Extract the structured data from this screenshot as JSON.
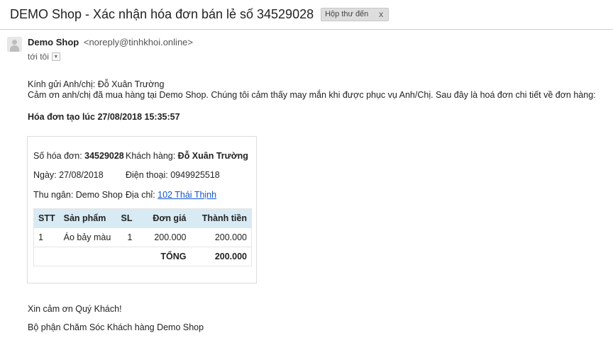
{
  "email": {
    "subject": "DEMO Shop - Xác nhận hóa đơn bán lẻ số 34529028",
    "label": "Hộp thư đến",
    "label_close": "x",
    "sender_name": "Demo Shop",
    "sender_email": "<noreply@tinhkhoi.online>",
    "to_text": "tới tôi",
    "to_toggle_icon": "▼"
  },
  "body": {
    "greeting": "Kính gửi Anh/chị: Đỗ Xuân Trường",
    "thanks": "Cảm ơn anh/chị đã mua hàng tại Demo Shop. Chúng tôi cảm thấy may mắn khi được phục vụ Anh/Chị. Sau đây là hoá đơn chi tiết về đơn hàng:",
    "created": "Hóa đơn tạo lúc 27/08/2018 15:35:57",
    "closing1": "Xin cảm ơn Quý Khách!",
    "closing2": "Bộ phận Chăm Sóc Khách hàng Demo Shop"
  },
  "invoice": {
    "number_label": "Số hóa đơn: ",
    "number": "34529028",
    "customer_label": "Khách hàng: ",
    "customer": "Đỗ Xuân Trường",
    "date_label": "Ngày: ",
    "date": "27/08/2018",
    "phone_label": "Điện thoại: ",
    "phone": "0949925518",
    "cashier_label": "Thu ngân: ",
    "cashier": "Demo Shop",
    "address_label": "Địa chỉ: ",
    "address": "102 Thái Thịnh"
  },
  "table": {
    "headers": [
      "STT",
      "Sản phẩm",
      "SL",
      "Đơn giá",
      "Thành tiền"
    ],
    "rows": [
      [
        "1",
        "Áo bảy màu",
        "1",
        "200.000",
        "200.000"
      ]
    ],
    "total_label": "TỔNG",
    "total_value": "200.000"
  },
  "colors": {
    "table_header_bg": "#d8eaf3",
    "link": "#1155cc"
  }
}
